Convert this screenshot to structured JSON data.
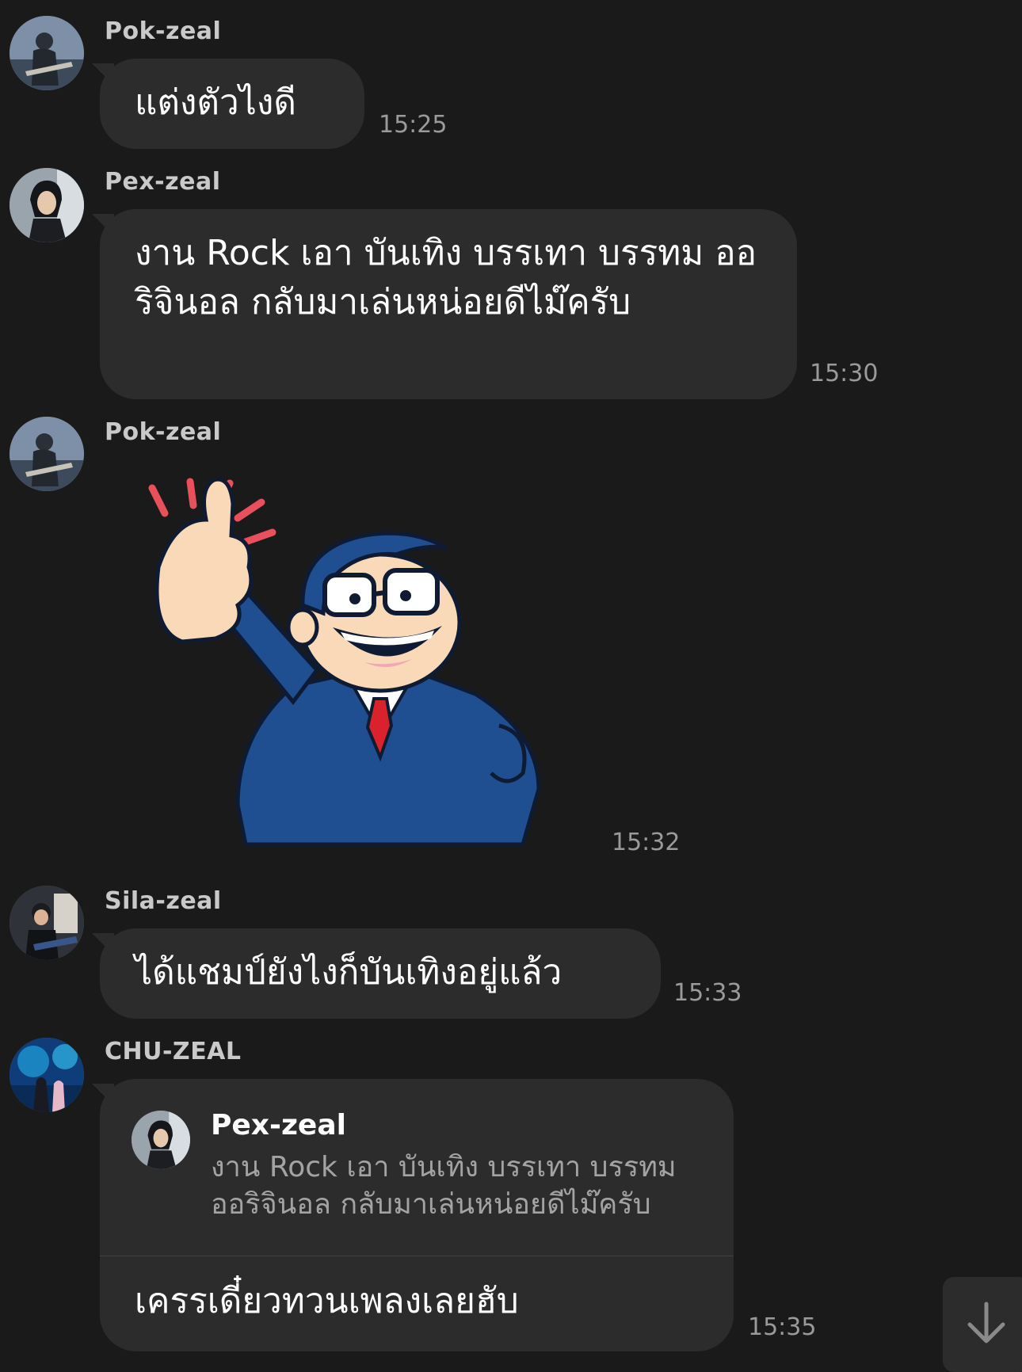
{
  "messages": [
    {
      "sender": "Pok-zeal",
      "text": "แต่งตัวไงดี",
      "time": "15:25",
      "avatar": "guitarist-avatar-1"
    },
    {
      "sender": "Pex-zeal",
      "text": "งาน Rock เอา บันเทิง บรรเทา บรรทม ออริจินอล กลับมาเล่นหน่อยดีไม๊ครับ",
      "time": "15:30",
      "avatar": "man-avatar"
    },
    {
      "sender": "Pok-zeal",
      "sticker": "thumbs-up-businessman-sticker",
      "time": "15:32",
      "avatar": "guitarist-avatar-1"
    },
    {
      "sender": "Sila-zeal",
      "text": "ได้แชมป์ยังไงก็บันเทิงอยู่แล้ว",
      "time": "15:33",
      "avatar": "guitarist-avatar-2"
    },
    {
      "sender": "CHU-ZEAL",
      "avatar": "aquarium-avatar",
      "quote": {
        "name": "Pex-zeal",
        "text": "งาน Rock เอา บันเทิง บรรเทา บรรทม ออริจินอล กลับมาเล่นหน่อยดีไม๊ครับ"
      },
      "text": "เครรเดี๋ยวทวนเพลงเลยฮับ",
      "time": "15:35"
    }
  ],
  "scroll_button": {
    "icon": "arrow-down-icon"
  },
  "colors": {
    "background": "#1a1a1b",
    "bubble": "#2c2c2d",
    "time": "#9a9a9a",
    "sender": "#c9c9c9"
  }
}
